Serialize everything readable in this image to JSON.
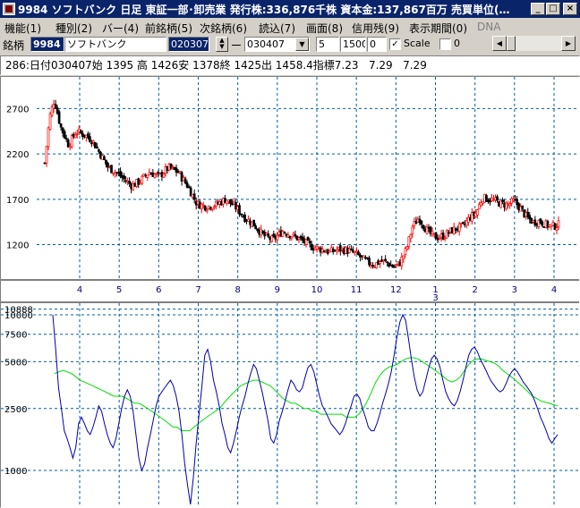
{
  "window": {
    "title": "9984 ソフトバンク 日足 東証一部･卸売業 発行株:336,876千株 資本金:137,867百万 売買単位(…",
    "minimize": "_",
    "maximize": "□",
    "close": "×"
  },
  "menu": [
    {
      "label": "機能(1)"
    },
    {
      "label": "種別(2)"
    },
    {
      "label": "バー(4)"
    },
    {
      "label": "前銘柄(5)"
    },
    {
      "label": "次銘柄(6)"
    },
    {
      "label": "読込(7)"
    },
    {
      "label": "画面(8)"
    },
    {
      "label": "信用残(9)"
    },
    {
      "label": "表示期間(0)"
    },
    {
      "label": "DNA"
    }
  ],
  "toolbar": {
    "stock_label": "銘柄",
    "stock_code": "9984",
    "stock_name": "ソフトバンク",
    "date_from": "020307",
    "dash": "ー",
    "date_to": "030407",
    "param1": "5",
    "param2": "1500",
    "param3": "0",
    "scale_label": "Scale",
    "scale_checked": "✓",
    "zero_label": "0"
  },
  "status_line": "286:日付030407始 1395 高 1426安 1378終 1425出 1458.4指標7.23   7.29   7.29",
  "chart_data": [
    {
      "type": "candlestick",
      "ylim": [
        850,
        3000
      ],
      "y_ticks": [
        1200,
        1700,
        2200,
        2700
      ],
      "x_ticks": [
        "4",
        "5",
        "6",
        "7",
        "8",
        "9",
        "10",
        "11",
        "12",
        "1",
        "2",
        "3",
        "4"
      ],
      "x_subtick": "3",
      "n_bars": 286,
      "up_color": "#ff0000",
      "down_color": "#000000",
      "grid": true,
      "close_path": [
        [
          0,
          2100
        ],
        [
          3,
          2600
        ],
        [
          6,
          2800
        ],
        [
          10,
          2500
        ],
        [
          15,
          2300
        ],
        [
          20,
          2450
        ],
        [
          26,
          2400
        ],
        [
          30,
          2350
        ],
        [
          35,
          2200
        ],
        [
          40,
          2050
        ],
        [
          45,
          2000
        ],
        [
          50,
          1920
        ],
        [
          55,
          1850
        ],
        [
          60,
          1900
        ],
        [
          66,
          2000
        ],
        [
          72,
          1950
        ],
        [
          78,
          2050
        ],
        [
          84,
          2000
        ],
        [
          90,
          1850
        ],
        [
          96,
          1650
        ],
        [
          102,
          1620
        ],
        [
          108,
          1640
        ],
        [
          114,
          1700
        ],
        [
          120,
          1620
        ],
        [
          126,
          1500
        ],
        [
          132,
          1420
        ],
        [
          138,
          1300
        ],
        [
          144,
          1250
        ],
        [
          150,
          1350
        ],
        [
          156,
          1300
        ],
        [
          162,
          1250
        ],
        [
          168,
          1180
        ],
        [
          174,
          1150
        ],
        [
          180,
          1120
        ],
        [
          186,
          1150
        ],
        [
          192,
          1130
        ],
        [
          196,
          1100
        ],
        [
          200,
          1050
        ],
        [
          204,
          1000
        ],
        [
          208,
          980
        ],
        [
          212,
          1020
        ],
        [
          216,
          1000
        ],
        [
          220,
          950
        ],
        [
          224,
          1000
        ],
        [
          228,
          1150
        ],
        [
          232,
          1400
        ],
        [
          236,
          1500
        ],
        [
          240,
          1380
        ],
        [
          244,
          1300
        ],
        [
          248,
          1280
        ],
        [
          252,
          1300
        ],
        [
          256,
          1350
        ],
        [
          260,
          1380
        ],
        [
          264,
          1400
        ],
        [
          268,
          1500
        ],
        [
          272,
          1550
        ],
        [
          276,
          1720
        ],
        [
          280,
          1700
        ],
        [
          284,
          1680
        ],
        [
          288,
          1650
        ],
        [
          292,
          1640
        ],
        [
          296,
          1680
        ],
        [
          300,
          1600
        ],
        [
          304,
          1500
        ],
        [
          308,
          1450
        ],
        [
          312,
          1460
        ],
        [
          316,
          1420
        ],
        [
          320,
          1400
        ],
        [
          324,
          1420
        ]
      ],
      "x_span": 324
    },
    {
      "type": "line",
      "y_ticks": [
        "1000",
        "2500",
        "5000",
        "7500",
        "10000",
        "10888"
      ],
      "series": [
        {
          "color": "#0000b0",
          "values": [
            10000,
            6000,
            3400,
            2500,
            1800,
            1600,
            1400,
            1200,
            1400,
            2000,
            2200,
            2000,
            1800,
            1700,
            1900,
            2200,
            2600,
            2400,
            2000,
            1700,
            1500,
            1400,
            1600,
            2000,
            2500,
            3000,
            3300,
            3000,
            2400,
            1700,
            1200,
            1000,
            1100,
            1400,
            1700,
            2100,
            2600,
            3000,
            3200,
            3400,
            3600,
            3800,
            3500,
            3000,
            2400,
            1700,
            1100,
            800,
            600,
            900,
            1500,
            2300,
            3500,
            5500,
            6000,
            5000,
            3800,
            3200,
            2600,
            2000,
            1700,
            1400,
            1300,
            1500,
            1800,
            2200,
            2600,
            3000,
            3600,
            4200,
            4800,
            4500,
            3800,
            3200,
            2600,
            2100,
            1600,
            1500,
            1700,
            2100,
            2400,
            2800,
            3300,
            3800,
            3600,
            3300,
            3200,
            3400,
            4000,
            4600,
            4800,
            4300,
            3600,
            3000,
            2600,
            2400,
            2200,
            2000,
            1900,
            1800,
            1700,
            1800,
            2000,
            2300,
            2600,
            3000,
            3100,
            2900,
            2500,
            2200,
            1900,
            1800,
            1800,
            2000,
            2300,
            2700,
            3100,
            3600,
            4300,
            5500,
            7200,
            9000,
            10000,
            9200,
            7000,
            5200,
            4000,
            3300,
            3000,
            3200,
            3800,
            4500,
            5200,
            5500,
            5200,
            4600,
            3800,
            3200,
            2900,
            2700,
            2600,
            2800,
            3200,
            3800,
            4600,
            5500,
            6000,
            6200,
            5800,
            5200,
            4800,
            4400,
            4000,
            3700,
            3500,
            3300,
            3200,
            3300,
            3600,
            4000,
            4300,
            4500,
            4300,
            4000,
            3700,
            3500,
            3300,
            3100,
            2800,
            2500,
            2200,
            2000,
            1800,
            1600,
            1500,
            1600,
            1700
          ]
        },
        {
          "color": "#00e000",
          "values": [
            4200,
            4300,
            4400,
            4300,
            4200,
            4000,
            3800,
            3700,
            3600,
            3500,
            3400,
            3300,
            3200,
            3100,
            3000,
            3000,
            3000,
            2900,
            2800,
            2700,
            2700,
            2600,
            2500,
            2400,
            2300,
            2200,
            2100,
            2000,
            1900,
            1900,
            1800,
            1800,
            1800,
            1900,
            2000,
            2100,
            2200,
            2300,
            2400,
            2500,
            2700,
            2900,
            3100,
            3300,
            3500,
            3600,
            3700,
            3800,
            3800,
            3700,
            3600,
            3500,
            3300,
            3100,
            2900,
            2800,
            2700,
            2700,
            2600,
            2500,
            2500,
            2400,
            2400,
            2300,
            2300,
            2300,
            2300,
            2300,
            2300,
            2200,
            2200,
            2200,
            2300,
            2500,
            2800,
            3200,
            3700,
            4100,
            4400,
            4600,
            4700,
            4800,
            5000,
            5200,
            5300,
            5300,
            5200,
            5000,
            4800,
            4600,
            4400,
            4200,
            4000,
            3800,
            3700,
            3800,
            4000,
            4400,
            4800,
            5100,
            5200,
            5200,
            5100,
            5000,
            4900,
            4700,
            4400,
            4200,
            4000,
            3800,
            3600,
            3400,
            3200,
            3000,
            2900,
            2800,
            2750,
            2700,
            2650,
            2600
          ]
        }
      ]
    }
  ]
}
